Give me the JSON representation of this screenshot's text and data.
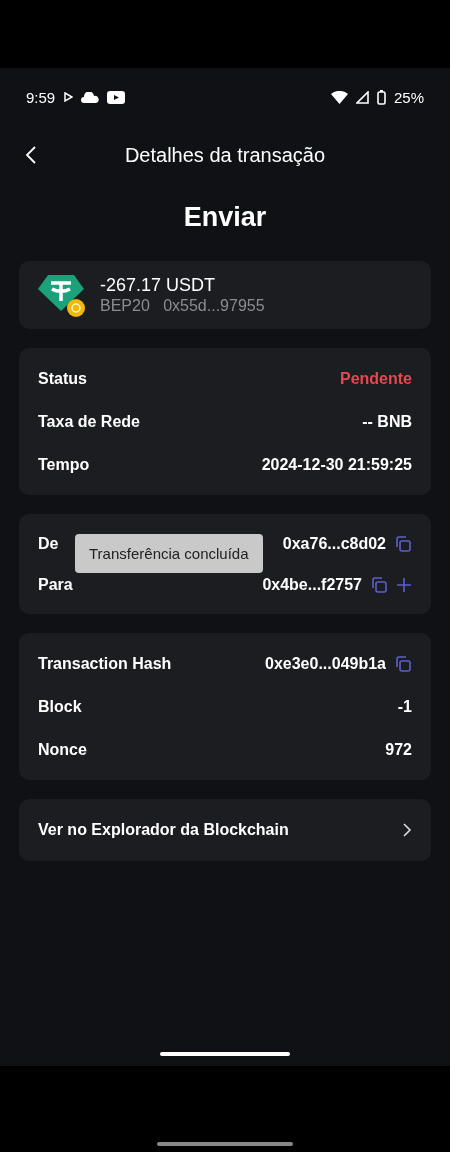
{
  "status_bar": {
    "time": "9:59",
    "battery": "25%"
  },
  "header": {
    "title": "Detalhes da transação"
  },
  "heading": "Enviar",
  "asset": {
    "amount": "-267.17 USDT",
    "network": "BEP20",
    "address": "0x55d...97955"
  },
  "sections": [
    {
      "rows": [
        {
          "label": "Status",
          "value": "Pendente",
          "kind": "alert",
          "copy": false,
          "add": false
        },
        {
          "label": "Taxa de Rede",
          "value": "-- BNB",
          "kind": "plain",
          "copy": false,
          "add": false
        },
        {
          "label": "Tempo",
          "value": "2024-12-30 21:59:25",
          "kind": "plain",
          "copy": false,
          "add": false
        }
      ]
    },
    {
      "rows": [
        {
          "label": "De",
          "value": "0xa76...c8d02",
          "kind": "plain",
          "copy": true,
          "add": false
        },
        {
          "label": "Para",
          "value": "0x4be...f2757",
          "kind": "plain",
          "copy": true,
          "add": true
        }
      ],
      "toast": "Transferência concluída"
    },
    {
      "rows": [
        {
          "label": "Transaction Hash",
          "value": "0xe3e0...049b1a",
          "kind": "plain",
          "copy": true,
          "add": false
        },
        {
          "label": "Block",
          "value": "-1",
          "kind": "plain",
          "copy": false,
          "add": false
        },
        {
          "label": "Nonce",
          "value": "972",
          "kind": "plain",
          "copy": false,
          "add": false
        }
      ]
    }
  ],
  "explorer_link": "Ver no Explorador da Blockchain"
}
